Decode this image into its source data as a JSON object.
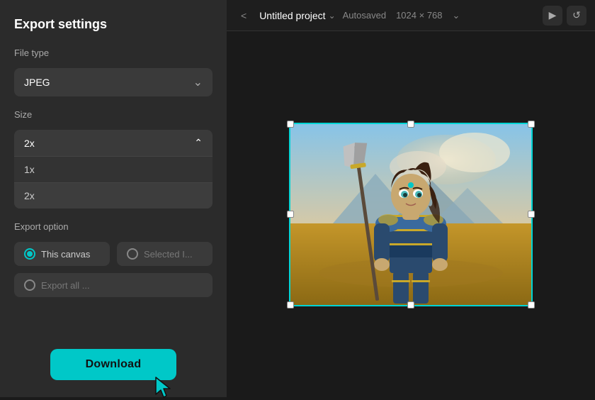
{
  "panel": {
    "title": "Export settings",
    "file_type_label": "File type",
    "file_type_value": "JPEG",
    "size_label": "Size",
    "size_value": "2x",
    "size_options": [
      "1x",
      "2x"
    ],
    "export_option_label": "Export option",
    "export_options": [
      {
        "id": "this_canvas",
        "label": "This canvas",
        "checked": true
      },
      {
        "id": "selected",
        "label": "Selected I...",
        "checked": false
      },
      {
        "id": "export_all",
        "label": "Export all ...",
        "checked": false
      }
    ],
    "download_label": "Download"
  },
  "topbar": {
    "back_label": "<",
    "project_name": "Untitled project",
    "autosaved_label": "Autosaved",
    "dimensions": "1024 × 768",
    "play_icon": "▶",
    "rotate_icon": "↺"
  }
}
